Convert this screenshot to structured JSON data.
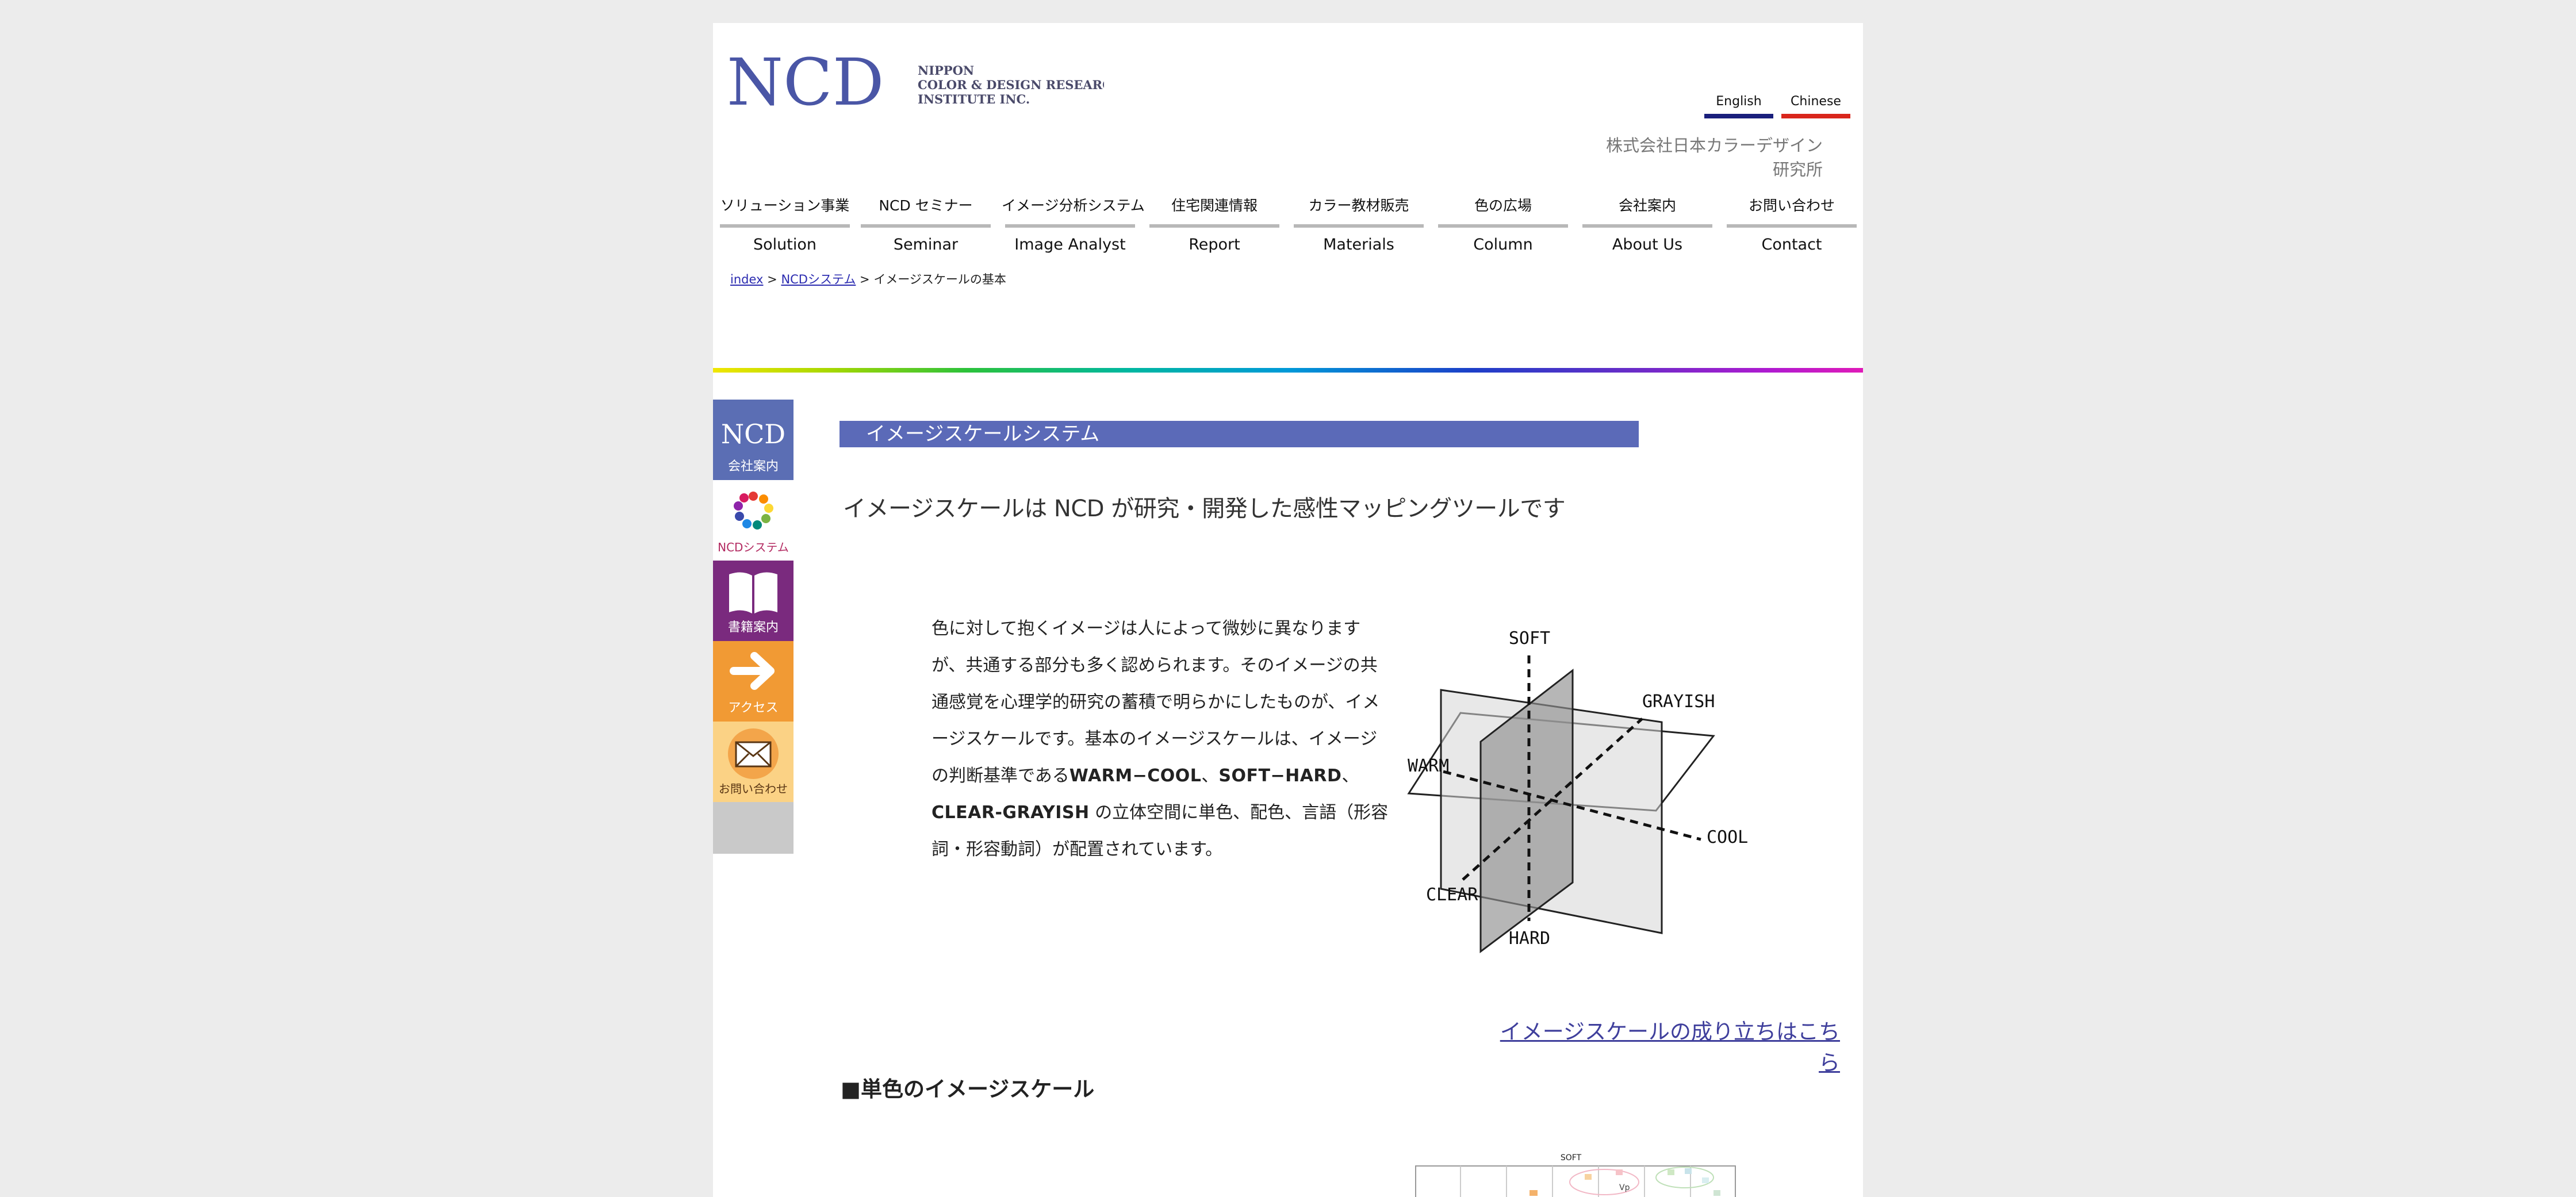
{
  "header": {
    "logo_letters": "NCD",
    "logo_name_lines": [
      "NIPPON",
      "COLOR & DESIGN RESEARCH",
      "INSTITUTE INC."
    ],
    "lang": {
      "english": "English",
      "chinese": "Chinese"
    },
    "company_jp": "株式会社日本カラーデザイン研究所"
  },
  "nav": [
    {
      "jp": "ソリューション事業",
      "en": "Solution"
    },
    {
      "jp": "NCD セミナー",
      "en": "Seminar"
    },
    {
      "jp": "イメージ分析システム",
      "en": "Image Analyst"
    },
    {
      "jp": "住宅関連情報",
      "en": "Report"
    },
    {
      "jp": "カラー教材販売",
      "en": "Materials"
    },
    {
      "jp": "色の広場",
      "en": "Column"
    },
    {
      "jp": "会社案内",
      "en": "About Us"
    },
    {
      "jp": "お問い合わせ",
      "en": "Contact"
    }
  ],
  "breadcrumb": {
    "index": "index",
    "sep": ">",
    "system": "NCDシステム",
    "current": "イメージスケールの基本"
  },
  "side": {
    "company": "会社案内",
    "system": "NCDシステム",
    "books": "書籍案内",
    "access": "アクセス",
    "contact": "お問い合わせ"
  },
  "main": {
    "section_title": "イメージスケールシステム",
    "headline": "イメージスケールは NCD が研究・開発した感性マッピングツールです",
    "intro_part1": "色に対して抱くイメージは人によって微妙に異なりますが、共通する部分も多く認められます。そのイメージの共通感覚を心理学的研究の蓄積で明らかにしたものが、イメージスケールです。基本のイメージスケールは、イメージの判断基準である",
    "intro_bold1": "WARM−COOL",
    "intro_sep1": "、",
    "intro_bold2": "SOFT−HARD",
    "intro_sep2": "、",
    "intro_bold3": "CLEAR-GRAYISH",
    "intro_part2": " の立体空間に単色、配色、言語（形容詞・形容動詞）が配置されています。",
    "axes": {
      "soft": "SOFT",
      "hard": "HARD",
      "warm": "WARM",
      "cool": "COOL",
      "clear": "CLEAR",
      "grayish": "GRAYISH"
    },
    "origin_link": "イメージスケールの成り立ちはこちら",
    "subhead": "■単色のイメージスケール",
    "preview": {
      "soft": "SOFT",
      "vp": "Vp"
    }
  },
  "colors": {
    "brand_blue": "#5b6ab8",
    "logo_blue": "#4a56a6",
    "english_underline": "#1a1f7c",
    "chinese_underline": "#d9261c",
    "access_orange": "#f19a34",
    "books_purple": "#7a2a7e",
    "contact_yellow": "#fbd285",
    "link_color": "#3f3f9c"
  },
  "icons": {
    "side_company": "ncd-logo-icon",
    "side_system": "color-circle-icon",
    "side_books": "open-book-icon",
    "side_access": "arrow-right-icon",
    "side_contact": "envelope-icon"
  }
}
